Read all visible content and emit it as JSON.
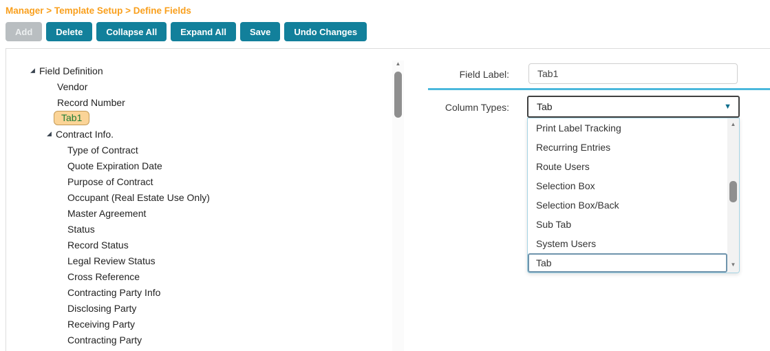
{
  "breadcrumb": {
    "text": "Manager > Template Setup > Define Fields"
  },
  "toolbar": {
    "buttons": [
      {
        "label": "Add",
        "disabled": true
      },
      {
        "label": "Delete"
      },
      {
        "label": "Collapse All"
      },
      {
        "label": "Expand All"
      },
      {
        "label": "Save"
      },
      {
        "label": "Undo Changes"
      }
    ]
  },
  "tree": {
    "items": [
      {
        "label": "Field Definition",
        "indent": 35,
        "expander": true
      },
      {
        "label": "Vendor",
        "indent": 74
      },
      {
        "label": "Record Number",
        "indent": 74
      },
      {
        "label": "Tab1",
        "indent": 74,
        "selected": true
      },
      {
        "label": "Contract Info.",
        "indent": 59,
        "expander": true
      },
      {
        "label": "Type of Contract",
        "indent": 89
      },
      {
        "label": "Quote Expiration Date",
        "indent": 89
      },
      {
        "label": "Purpose of Contract",
        "indent": 89
      },
      {
        "label": "Occupant (Real Estate Use Only)",
        "indent": 89
      },
      {
        "label": "Master Agreement",
        "indent": 89
      },
      {
        "label": "Status",
        "indent": 89
      },
      {
        "label": "Record Status",
        "indent": 89
      },
      {
        "label": "Legal Review Status",
        "indent": 89
      },
      {
        "label": "Cross Reference",
        "indent": 89
      },
      {
        "label": "Contracting Party Info",
        "indent": 89
      },
      {
        "label": "Disclosing Party",
        "indent": 89
      },
      {
        "label": "Receiving Party",
        "indent": 89
      },
      {
        "label": "Contracting Party",
        "indent": 89
      }
    ]
  },
  "form": {
    "field_label": {
      "label": "Field Label:",
      "value": "Tab1"
    },
    "column_types": {
      "label": "Column Types:",
      "value": "Tab"
    },
    "dropdown": {
      "options": [
        {
          "label": "Print Label Tracking"
        },
        {
          "label": "Recurring Entries"
        },
        {
          "label": "Route Users"
        },
        {
          "label": "Selection Box"
        },
        {
          "label": "Selection Box/Back"
        },
        {
          "label": "Sub Tab"
        },
        {
          "label": "System Users"
        },
        {
          "label": "Tab",
          "focused": true
        }
      ]
    }
  },
  "icons": {
    "tree_expander_icon": "◢",
    "scroll_up_icon": "▲",
    "scroll_down_icon": "▼",
    "select_dropdown_icon": "▼"
  },
  "colors": {
    "breadcrumb_orange": "#F99F1C",
    "button_teal": "#12809B",
    "button_disabled_gray": "#B9BEC1",
    "selected_node_bg": "#FBD497",
    "selected_node_border": "#C49A56",
    "selected_node_text": "#1E7D35",
    "separator_blue": "#4BB8DC",
    "select_arrow_teal": "#0D6D8C"
  }
}
